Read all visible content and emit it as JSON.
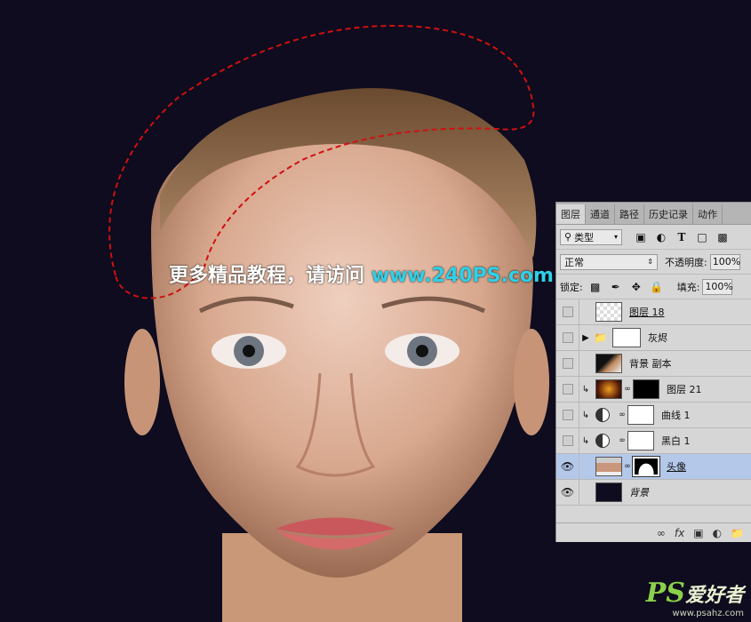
{
  "watermark": {
    "text": "更多精品教程，请访问",
    "url": "www.240PS.com"
  },
  "brand": {
    "logo": "PS",
    "logo_suffix": "爱好者",
    "site": "www.psahz.com"
  },
  "panel": {
    "tabs": [
      "图层",
      "通道",
      "路径",
      "历史记录",
      "动作"
    ],
    "filter": {
      "icon": "search-icon",
      "label": "类型"
    },
    "blend_mode": "正常",
    "opacity": {
      "label": "不透明度:",
      "value": "100%"
    },
    "lock": {
      "label": "锁定:"
    },
    "fill": {
      "label": "填充:",
      "value": "100%"
    },
    "layers": [
      {
        "name": "图层 18",
        "visible": false
      },
      {
        "name": "灰烬",
        "visible": false,
        "type": "group"
      },
      {
        "name": "背景 副本",
        "visible": false
      },
      {
        "name": "图层 21",
        "visible": false
      },
      {
        "name": "曲线 1",
        "visible": false
      },
      {
        "name": "黑白 1",
        "visible": false
      },
      {
        "name": "头像",
        "visible": true,
        "selected": true
      },
      {
        "name": "背景",
        "visible": true
      }
    ]
  },
  "colors": {
    "canvas_bg": "#0e0c1e",
    "selection": "#d01010",
    "selected_layer": "#b4c8ea"
  }
}
